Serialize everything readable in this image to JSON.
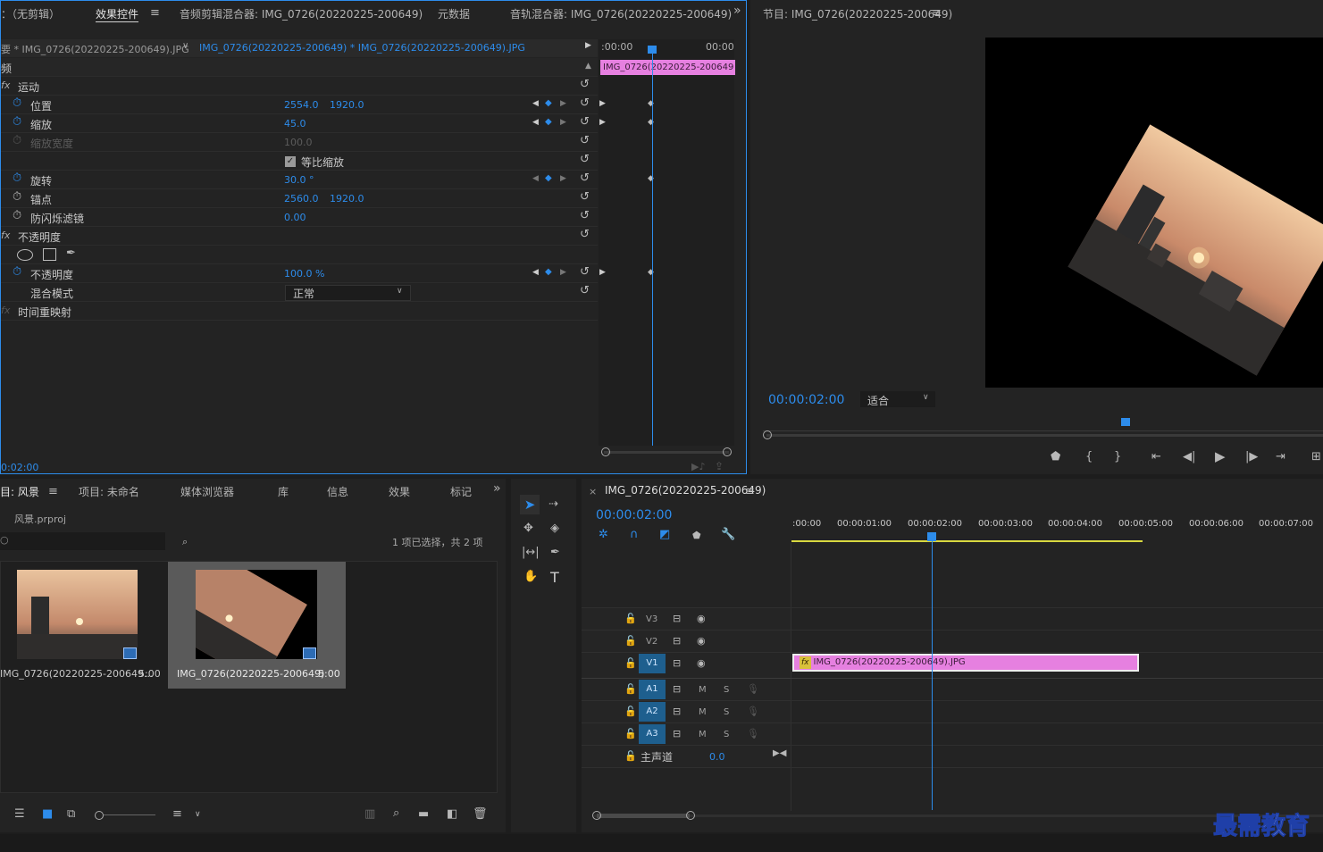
{
  "effect_controls": {
    "tabs": [
      "：（无剪辑）",
      "效果控件",
      "音频剪辑混合器: IMG_0726(20220225-200649)",
      "元数据",
      "音轨混合器: IMG_0726(20220225-200649)"
    ],
    "overflow": "»",
    "source_clip": "要 * IMG_0726(20220225-200649).JPG",
    "seq_clip": "IMG_0726(20220225-200649) * IMG_0726(20220225-200649).JPG",
    "section_video": "频",
    "time_start": ":00:00",
    "time_end": "00:00",
    "mini_clip": "IMG_0726(20220225-200649",
    "fx_motion": "运动",
    "fx": "fx",
    "position_label": "位置",
    "position_x": "2554.0",
    "position_y": "1920.0",
    "scale_label": "缩放",
    "scale_value": "45.0",
    "scale_width_label": "缩放宽度",
    "scale_width_value": "100.0",
    "uniform_label": "等比缩放",
    "rotation_label": "旋转",
    "rotation_value": "30.0 °",
    "anchor_label": "锚点",
    "anchor_x": "2560.0",
    "anchor_y": "1920.0",
    "antiflicker_label": "防闪烁滤镜",
    "antiflicker_value": "0.00",
    "fx_opacity": "不透明度",
    "opacity_label": "不透明度",
    "opacity_value": "100.0 %",
    "blend_label": "混合模式",
    "blend_value": "正常",
    "fx_time_remap": "时间重映射",
    "timecode": "0:02:00"
  },
  "program": {
    "title": "节目: IMG_0726(20220225-200649)",
    "timecode": "00:00:02:00",
    "fit": "适合"
  },
  "project": {
    "tabs": [
      "目: 风景",
      "项目: 未命名",
      "媒体浏览器",
      "库",
      "信息",
      "效果",
      "标记"
    ],
    "file": "风景.prproj",
    "selection_status": "1 项已选择，共 2 项",
    "items": [
      {
        "name": "IMG_0726(20220225-200649...",
        "duration": "5:00"
      },
      {
        "name": "IMG_0726(20220225-200649)",
        "duration": "5:00"
      }
    ]
  },
  "timeline": {
    "title": "IMG_0726(20220225-200649)",
    "close": "×",
    "timecode": "00:00:02:00",
    "ruler": [
      ":00:00",
      "00:00:01:00",
      "00:00:02:00",
      "00:00:03:00",
      "00:00:04:00",
      "00:00:05:00",
      "00:00:06:00",
      "00:00:07:00"
    ],
    "tracks": {
      "v3": "V3",
      "v2": "V2",
      "v1": "V1",
      "a1": "A1",
      "a2": "A2",
      "a3": "A3",
      "m": "M",
      "s": "S"
    },
    "master_label": "主声道",
    "master_value": "0.0",
    "clip_fx": "fx",
    "clip_name": "IMG_0726(20220225-200649).JPG"
  },
  "watermark": "最需教育",
  "colors": {
    "accent": "#2d8ceb",
    "clip": "#e680e0",
    "panel": "#232323"
  }
}
